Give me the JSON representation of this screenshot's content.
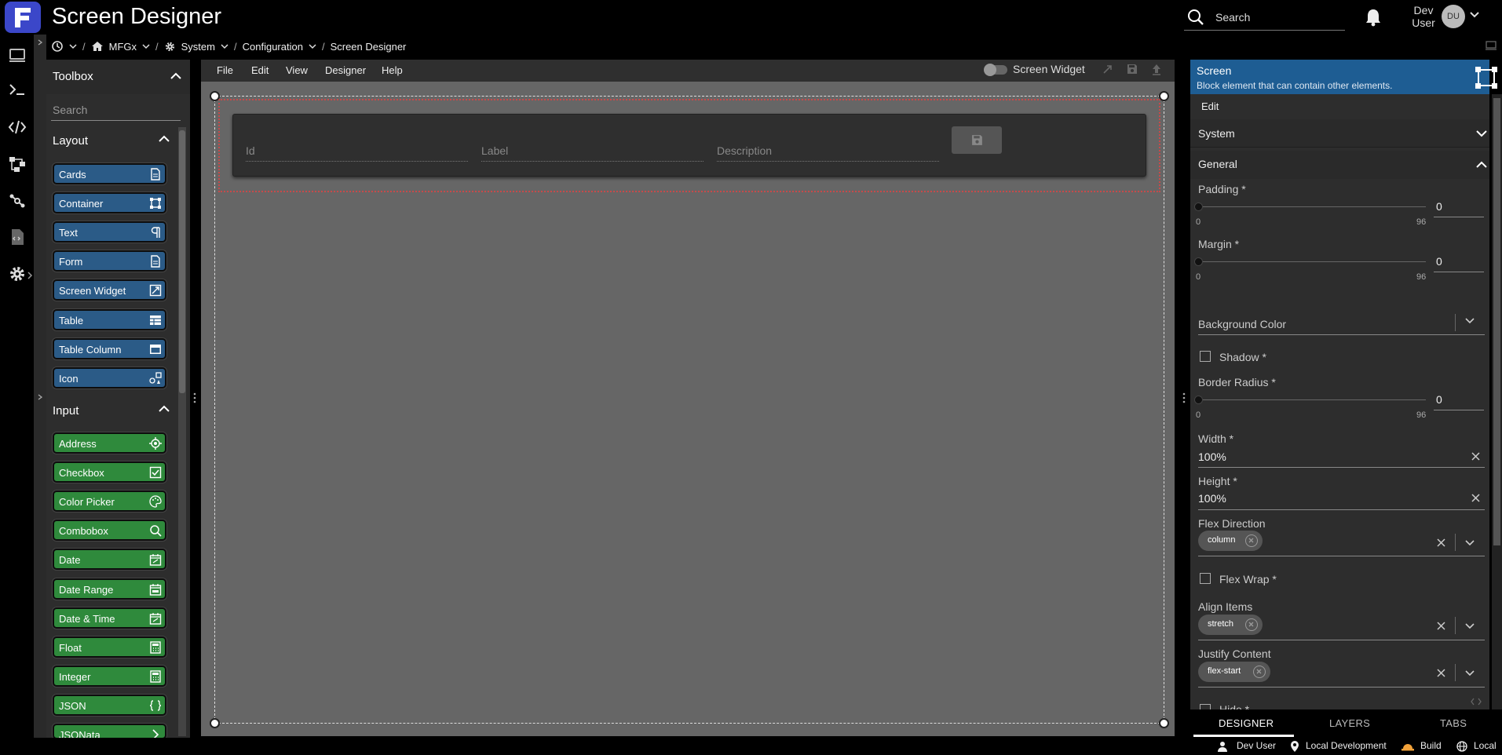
{
  "app": {
    "title": "Screen Designer",
    "search_label": "Search",
    "user_name": "Dev User",
    "user_initials": "DU",
    "logo_letter": "F"
  },
  "breadcrumb": {
    "items": [
      "MFGx",
      "System",
      "Configuration",
      "Screen Designer"
    ]
  },
  "toolbox": {
    "title": "Toolbox",
    "search_placeholder": "Search",
    "layout_title": "Layout",
    "layout_items": [
      "Cards",
      "Container",
      "Text",
      "Form",
      "Screen Widget",
      "Table",
      "Table Column",
      "Icon"
    ],
    "input_title": "Input",
    "input_items": [
      "Address",
      "Checkbox",
      "Color Picker",
      "Combobox",
      "Date",
      "Date Range",
      "Date & Time",
      "Float",
      "Integer",
      "JSON",
      "JSONata"
    ]
  },
  "designer": {
    "menu": [
      "File",
      "Edit",
      "View",
      "Designer",
      "Help"
    ],
    "screen_widget_label": "Screen Widget",
    "form_fields": [
      "Id",
      "Label",
      "Description"
    ]
  },
  "properties": {
    "header_title": "Screen",
    "header_subtitle": "Block element that can contain other elements.",
    "edit_label": "Edit",
    "system_label": "System",
    "general_label": "General",
    "padding_label": "Padding *",
    "padding_value": "0",
    "padding_min": "0",
    "padding_max": "96",
    "margin_label": "Margin *",
    "margin_value": "0",
    "margin_min": "0",
    "margin_max": "96",
    "background_label": "Background Color",
    "shadow_label": "Shadow *",
    "border_radius_label": "Border Radius *",
    "border_radius_value": "0",
    "border_radius_min": "0",
    "border_radius_max": "96",
    "width_label": "Width *",
    "width_value": "100%",
    "height_label": "Height *",
    "height_value": "100%",
    "flex_direction_label": "Flex Direction",
    "flex_direction_value": "column",
    "flex_wrap_label": "Flex Wrap *",
    "align_items_label": "Align Items",
    "align_items_value": "stretch",
    "justify_content_label": "Justify Content",
    "justify_content_value": "flex-start",
    "hide_label": "Hide *"
  },
  "tabs": [
    "DESIGNER",
    "LAYERS",
    "TABS"
  ],
  "status": {
    "user": "Dev User",
    "environment": "Local Development",
    "build": "Build",
    "locale": "Local"
  }
}
